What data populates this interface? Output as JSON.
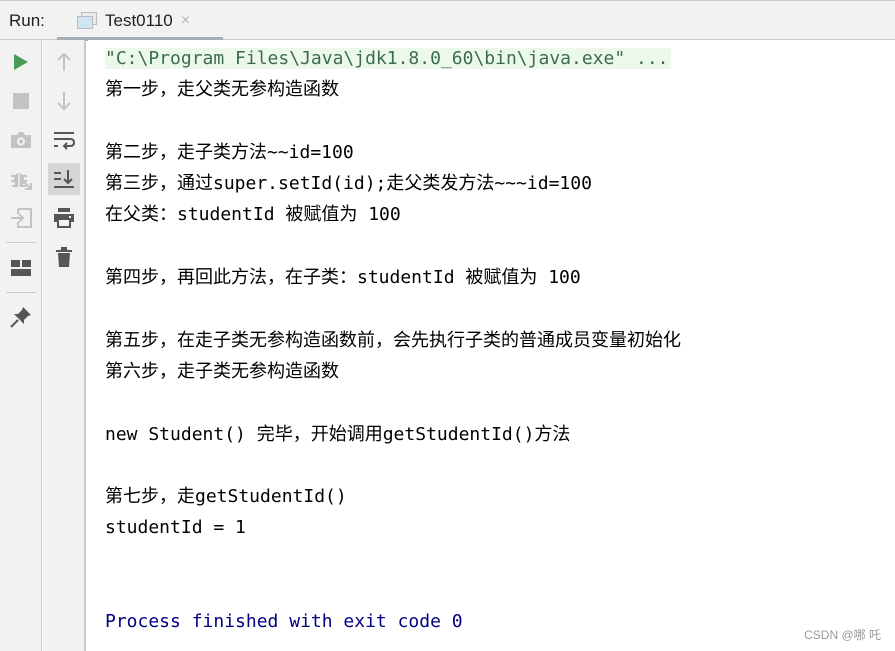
{
  "header": {
    "run_label": "Run:",
    "tab_title": "Test0110",
    "tab_close_glyph": "×"
  },
  "toolbar_left": [
    {
      "name": "rerun-icon",
      "enabled": true
    },
    {
      "name": "stop-icon",
      "enabled": false
    },
    {
      "name": "camera-icon",
      "enabled": false
    },
    {
      "name": "debug-exit-icon",
      "enabled": false
    },
    {
      "name": "import-icon",
      "enabled": false
    },
    {
      "name": "layout-icon",
      "enabled": true
    },
    {
      "name": "pin-icon",
      "enabled": true
    }
  ],
  "toolbar_right": [
    {
      "name": "up-arrow-icon",
      "enabled": false
    },
    {
      "name": "down-arrow-icon",
      "enabled": false
    },
    {
      "name": "soft-wrap-icon",
      "enabled": true
    },
    {
      "name": "scroll-to-end-icon",
      "enabled": true,
      "active": true
    },
    {
      "name": "print-icon",
      "enabled": true
    },
    {
      "name": "trash-icon",
      "enabled": true
    }
  ],
  "console": {
    "command": "\"C:\\Program Files\\Java\\jdk1.8.0_60\\bin\\java.exe\" ...",
    "lines": [
      "第一步，走父类无参构造函数",
      "",
      "第二步，走子类方法~~id=100",
      "第三步，通过super.setId(id);走父类发方法~~~id=100",
      "在父类：studentId 被赋值为 100",
      "",
      "第四步，再回此方法，在子类：studentId 被赋值为 100",
      "",
      "第五步，在走子类无参构造函数前，会先执行子类的普通成员变量初始化",
      "第六步，走子类无参构造函数",
      "",
      "new Student() 完毕，开始调用getStudentId()方法",
      "",
      "第七步，走getStudentId()",
      "studentId = 1",
      "",
      ""
    ],
    "exit_message": "Process finished with exit code 0"
  },
  "watermark": "CSDN @哪 吒",
  "colors": {
    "rerun_green": "#499c54",
    "exit_text": "#000080",
    "cmd_text": "#3b6b53",
    "cmd_bg": "#edf8ed"
  }
}
